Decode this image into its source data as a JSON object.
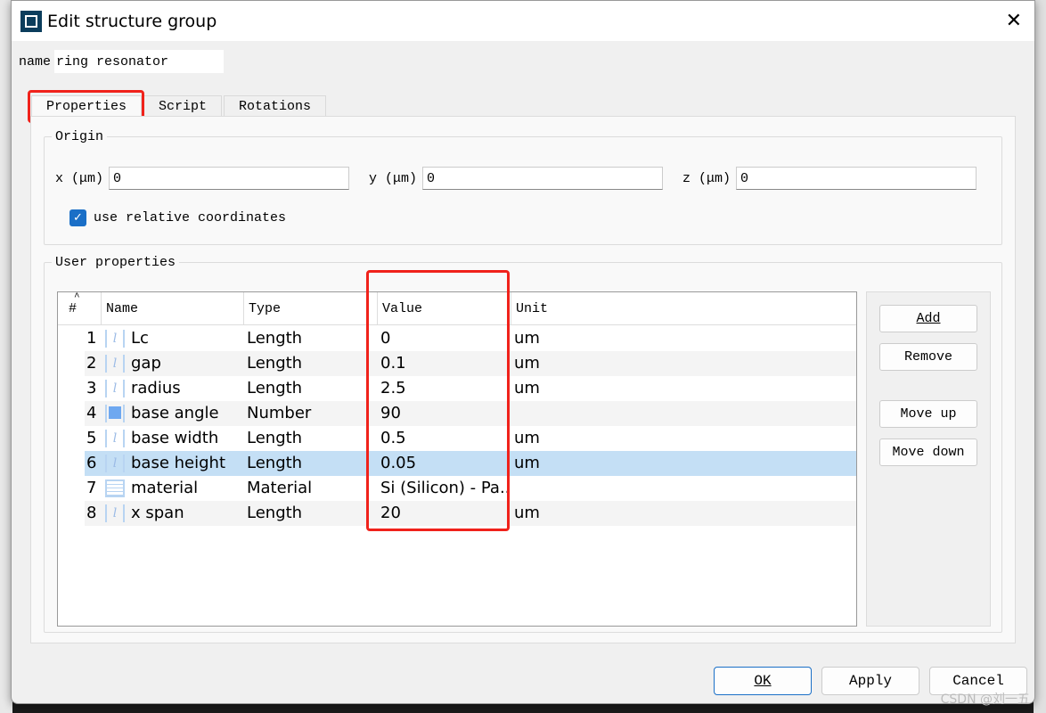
{
  "window": {
    "title": "Edit structure group"
  },
  "name_field": {
    "label": "name",
    "value": "ring resonator"
  },
  "tabs": [
    {
      "label": "Properties"
    },
    {
      "label": "Script"
    },
    {
      "label": "Rotations"
    }
  ],
  "origin": {
    "legend": "Origin",
    "x_label": "x (μm)",
    "x_value": "0",
    "y_label": "y (μm)",
    "y_value": "0",
    "z_label": "z (μm)",
    "z_value": "0",
    "relative_label": "use relative coordinates",
    "relative_checked": true
  },
  "user_properties": {
    "legend": "User properties",
    "columns": [
      "#",
      "Name",
      "Type",
      "Value",
      "Unit"
    ],
    "rows": [
      {
        "n": "1",
        "icon": "length",
        "name": "Lc",
        "type": "Length",
        "value": "0",
        "unit": "um"
      },
      {
        "n": "2",
        "icon": "length",
        "name": "gap",
        "type": "Length",
        "value": "0.1",
        "unit": "um"
      },
      {
        "n": "3",
        "icon": "length",
        "name": "radius",
        "type": "Length",
        "value": "2.5",
        "unit": "um"
      },
      {
        "n": "4",
        "icon": "number",
        "name": "base angle",
        "type": "Number",
        "value": "90",
        "unit": ""
      },
      {
        "n": "5",
        "icon": "length",
        "name": "base width",
        "type": "Length",
        "value": "0.5",
        "unit": "um"
      },
      {
        "n": "6",
        "icon": "length",
        "name": "base height",
        "type": "Length",
        "value": "0.05",
        "unit": "um",
        "selected": true
      },
      {
        "n": "7",
        "icon": "material",
        "name": "material",
        "type": "Material",
        "value": "Si (Silicon) - Pa...",
        "unit": ""
      },
      {
        "n": "8",
        "icon": "length",
        "name": "x span",
        "type": "Length",
        "value": "20",
        "unit": "um"
      }
    ]
  },
  "side_buttons": {
    "add": "Add",
    "remove": "Remove",
    "move_up": "Move up",
    "move_down": "Move down"
  },
  "footer": {
    "ok": "OK",
    "apply": "Apply",
    "cancel": "Cancel"
  },
  "watermark": "CSDN @刘一五",
  "colors": {
    "highlight": "#f0221b",
    "selected_row": "#c4dff5",
    "checkbox": "#1a6fc7"
  }
}
